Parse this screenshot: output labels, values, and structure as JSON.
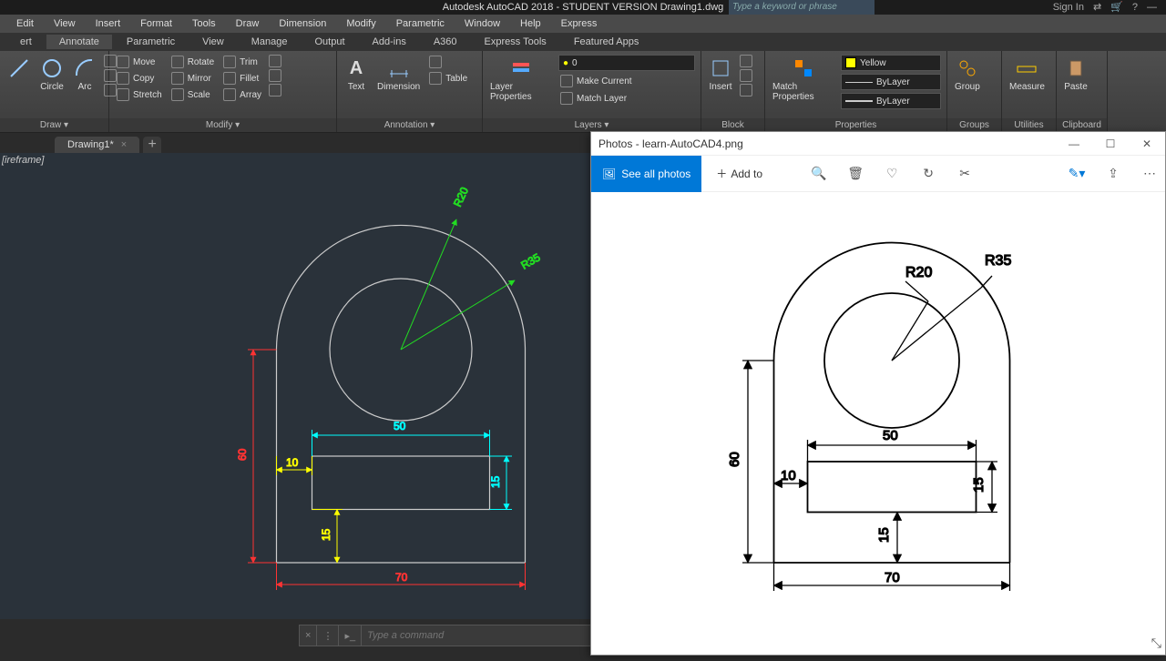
{
  "title": "Autodesk AutoCAD 2018 - STUDENT VERSION   Drawing1.dwg",
  "search_placeholder": "Type a keyword or phrase",
  "signin": "Sign In",
  "menu": [
    "Edit",
    "View",
    "Insert",
    "Format",
    "Tools",
    "Draw",
    "Dimension",
    "Modify",
    "Parametric",
    "Window",
    "Help",
    "Express"
  ],
  "ribbtabs": [
    "ert",
    "Annotate",
    "Parametric",
    "View",
    "Manage",
    "Output",
    "Add-ins",
    "A360",
    "Express Tools",
    "Featured Apps"
  ],
  "panels": {
    "draw": {
      "label": "Draw ▾",
      "tools": [
        "Circle",
        "Arc"
      ]
    },
    "modify": {
      "label": "Modify ▾",
      "rows": [
        [
          "Move",
          "Rotate",
          "Trim"
        ],
        [
          "Copy",
          "Mirror",
          "Fillet"
        ],
        [
          "Stretch",
          "Scale",
          "Array"
        ]
      ]
    },
    "annotation": {
      "label": "Annotation ▾",
      "text": "Text",
      "dim": "Dimension",
      "table": "Table"
    },
    "layers": {
      "label": "Layers ▾",
      "lp": "Layer Properties",
      "current": "0",
      "mc": "Make Current",
      "ml": "Match Layer"
    },
    "block": {
      "label": "Block",
      "insert": "Insert"
    },
    "propsPanel": {
      "label": "Properties",
      "match": "Match Properties",
      "color": "Yellow",
      "bylayer": "ByLayer"
    },
    "groups": {
      "label": "Groups",
      "group": "Group"
    },
    "util": {
      "label": "Utilities",
      "measure": "Measure"
    },
    "clip": {
      "label": "Clipboard",
      "paste": "Paste"
    }
  },
  "doctab": "Drawing1*",
  "wireframe": "[ireframe]",
  "cmd_placeholder": "Type a command",
  "photos": {
    "title": "Photos - learn-AutoCAD4.png",
    "see_all": "See all photos",
    "addto": "Add to"
  },
  "drawing": {
    "r20": "R20",
    "r35": "R35",
    "d50": "50",
    "d10": "10",
    "d15a": "15",
    "d15b": "15",
    "d70": "70",
    "d60": "60"
  },
  "ref": {
    "r20": "R20",
    "r35": "R35",
    "d50": "50",
    "d10": "10",
    "d15a": "15",
    "d15b": "15",
    "d70": "70",
    "d60": "60"
  }
}
